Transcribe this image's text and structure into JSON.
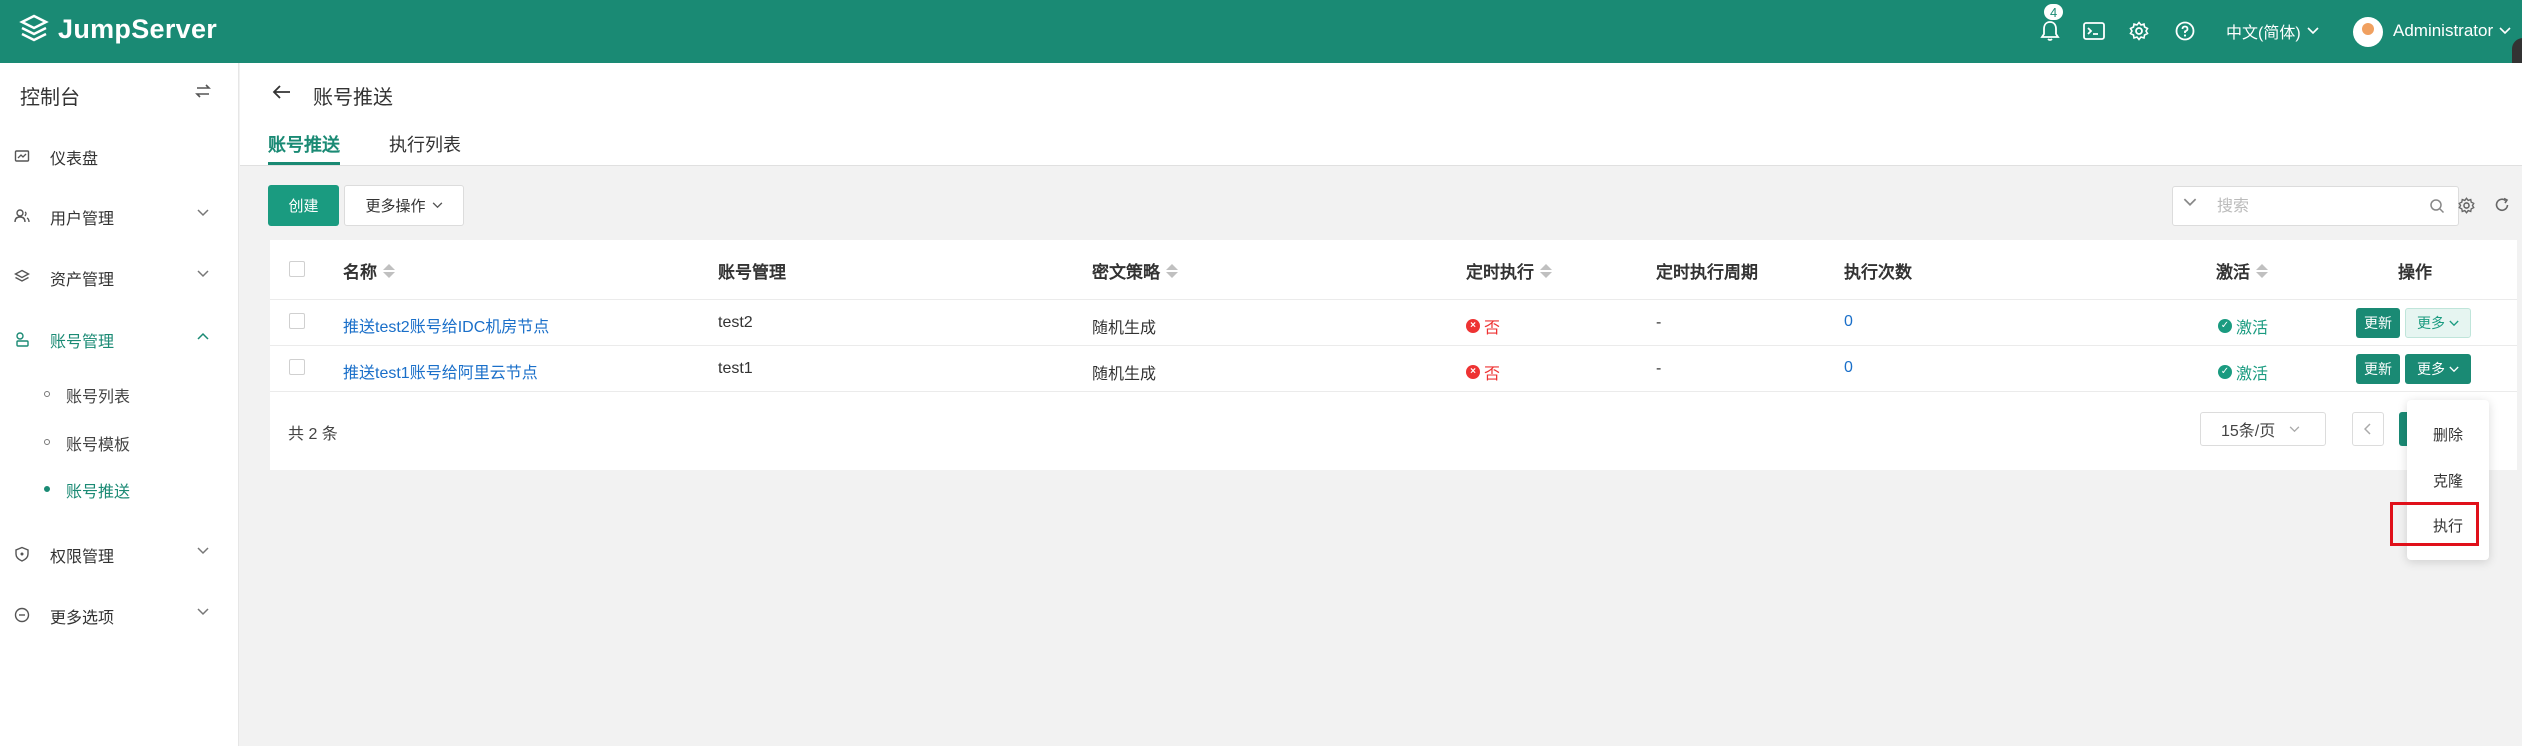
{
  "header": {
    "logo": "JumpServer",
    "notification_count": "4",
    "language": "中文(简体)",
    "user": "Administrator"
  },
  "sidebar": {
    "title": "控制台",
    "items": [
      {
        "label": "仪表盘",
        "icon": "dashboard-icon"
      },
      {
        "label": "用户管理",
        "icon": "users-icon"
      },
      {
        "label": "资产管理",
        "icon": "assets-icon"
      },
      {
        "label": "账号管理",
        "icon": "accounts-icon"
      },
      {
        "label": "权限管理",
        "icon": "permission-icon"
      },
      {
        "label": "更多选项",
        "icon": "more-options-icon"
      }
    ],
    "sub_items": [
      {
        "label": "账号列表"
      },
      {
        "label": "账号模板"
      },
      {
        "label": "账号推送"
      }
    ]
  },
  "page": {
    "title": "账号推送",
    "tabs": [
      "账号推送",
      "执行列表"
    ]
  },
  "toolbar": {
    "create": "创建",
    "more_actions": "更多操作",
    "search_placeholder": "搜索"
  },
  "table": {
    "headers": [
      "名称",
      "账号管理",
      "密文策略",
      "定时执行",
      "定时执行周期",
      "执行次数",
      "激活",
      "操作"
    ],
    "rows": [
      {
        "name": "推送test2账号给IDC机房节点",
        "account": "test2",
        "strategy": "随机生成",
        "periodic": "否",
        "period": "-",
        "count": "0",
        "active": "激活"
      },
      {
        "name": "推送test1账号给阿里云节点",
        "account": "test1",
        "strategy": "随机生成",
        "periodic": "否",
        "period": "-",
        "count": "0",
        "active": "激活"
      }
    ],
    "update_label": "更新",
    "more_label": "更多"
  },
  "footer": {
    "total": "共 2 条",
    "page_size": "15条/页"
  },
  "dropdown": {
    "items": [
      "删除",
      "克隆",
      "执行"
    ]
  },
  "colors": {
    "brand": "#1a8a74",
    "link": "#1a6fc9",
    "danger": "#e33333",
    "highlight": "#e0101a"
  }
}
